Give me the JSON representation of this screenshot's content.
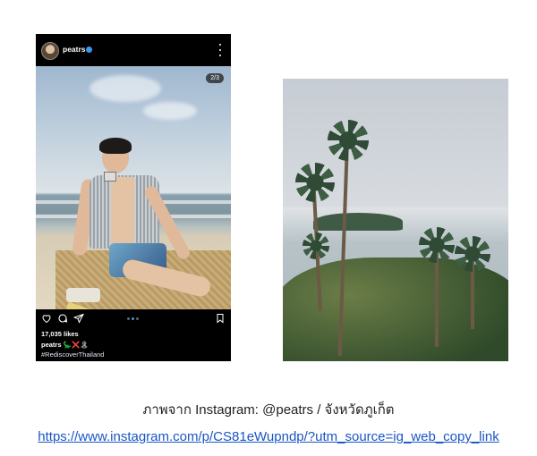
{
  "post": {
    "username": "peatrs",
    "slide_counter": "2/3",
    "likes": "17,035 likes",
    "caption_user": "peatrs",
    "caption_emoji": "🦕❌🏝",
    "hashtag": "#RediscoverThailand"
  },
  "icons": {
    "header": [
      "avatar",
      "verified-icon",
      "more-icon"
    ],
    "actions": [
      "heart-icon",
      "comment-icon",
      "share-icon",
      "carousel-dots",
      "save-icon"
    ],
    "tag": "user-tag-icon"
  },
  "colors": {
    "post_bg": "#000000",
    "verified": "#3897f0",
    "link": "#1a56c4"
  },
  "footer": {
    "credit": "ภาพจาก Instagram: @peatrs / จังหวัดภูเก็ต",
    "link": "https://www.instagram.com/p/CS81eWupndp/?utm_source=ig_web_copy_link"
  }
}
